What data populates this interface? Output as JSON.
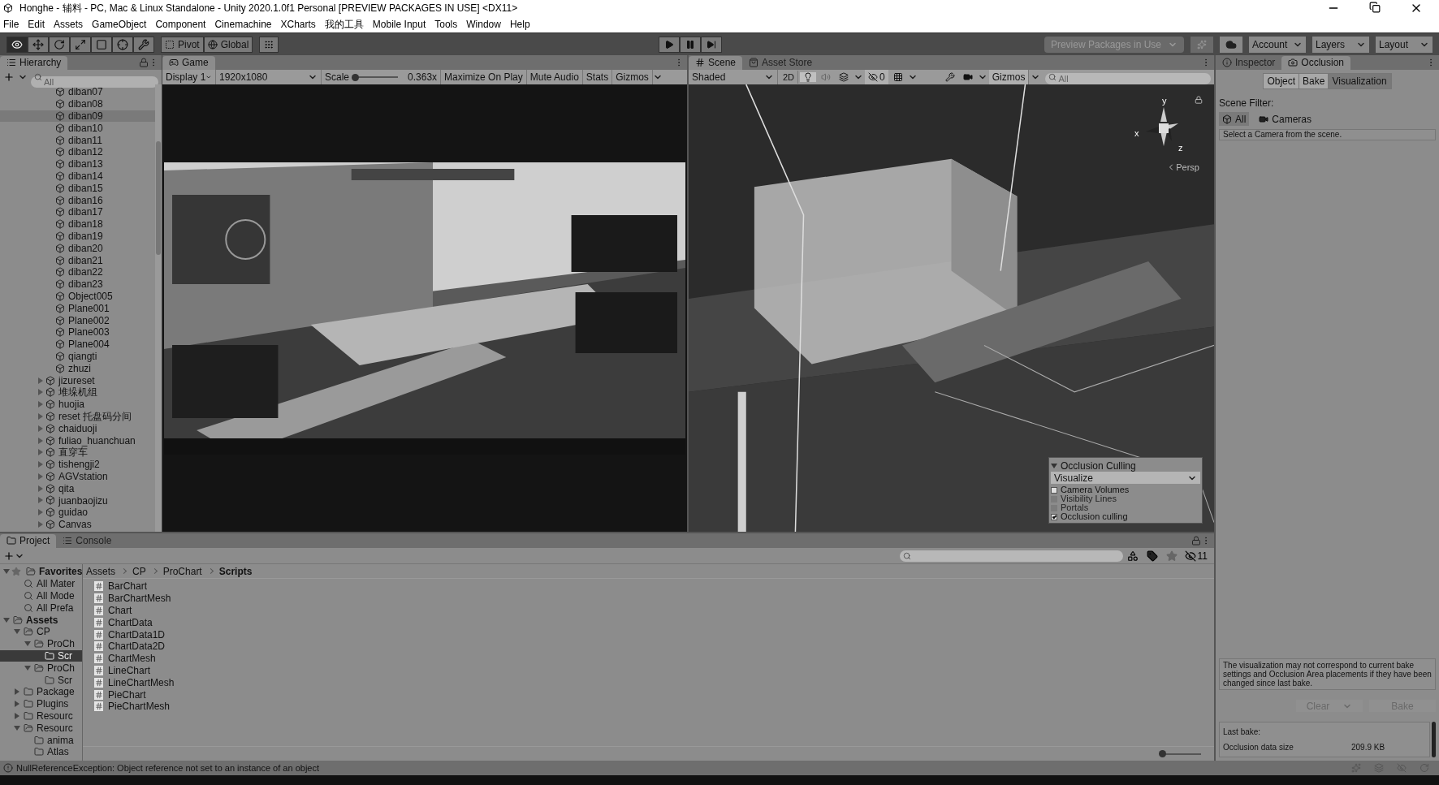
{
  "window": {
    "title": "Honghe - 辅料 - PC, Mac & Linux Standalone - Unity 2020.1.0f1 Personal [PREVIEW PACKAGES IN USE] <DX11>"
  },
  "menu": [
    "File",
    "Edit",
    "Assets",
    "GameObject",
    "Component",
    "Cinemachine",
    "XCharts",
    "我的工具",
    "Mobile Input",
    "Tools",
    "Window",
    "Help"
  ],
  "toolbar": {
    "tools": [
      {
        "kind": "view",
        "selected": true
      },
      {
        "kind": "move",
        "selected": false
      },
      {
        "kind": "rotate",
        "selected": false
      },
      {
        "kind": "scale",
        "selected": false
      },
      {
        "kind": "rect",
        "selected": false
      },
      {
        "kind": "transform",
        "selected": false
      },
      {
        "kind": "custom",
        "selected": false
      }
    ],
    "pivot": "Pivot",
    "space": "Global",
    "playback": [
      {
        "kind": "play",
        "on": false
      },
      {
        "kind": "pause",
        "on": false
      },
      {
        "kind": "step",
        "on": false
      }
    ],
    "preview_packages": {
      "label": "Preview Packages in Use",
      "disabled": true
    },
    "account": "Account",
    "layers": "Layers",
    "layout": "Layout"
  },
  "hierarchy": {
    "tab": "Hierarchy",
    "search_placeholder": "All",
    "items": [
      {
        "label": "diban07",
        "kind": "leaf",
        "selected": false
      },
      {
        "label": "diban08",
        "kind": "leaf",
        "selected": false
      },
      {
        "label": "diban09",
        "kind": "leaf",
        "selected": true
      },
      {
        "label": "diban10",
        "kind": "leaf",
        "selected": false
      },
      {
        "label": "diban11",
        "kind": "leaf",
        "selected": false
      },
      {
        "label": "diban12",
        "kind": "leaf",
        "selected": false
      },
      {
        "label": "diban13",
        "kind": "leaf",
        "selected": false
      },
      {
        "label": "diban14",
        "kind": "leaf",
        "selected": false
      },
      {
        "label": "diban15",
        "kind": "leaf",
        "selected": false
      },
      {
        "label": "diban16",
        "kind": "leaf",
        "selected": false
      },
      {
        "label": "diban17",
        "kind": "leaf",
        "selected": false
      },
      {
        "label": "diban18",
        "kind": "leaf",
        "selected": false
      },
      {
        "label": "diban19",
        "kind": "leaf",
        "selected": false
      },
      {
        "label": "diban20",
        "kind": "leaf",
        "selected": false
      },
      {
        "label": "diban21",
        "kind": "leaf",
        "selected": false
      },
      {
        "label": "diban22",
        "kind": "leaf",
        "selected": false
      },
      {
        "label": "diban23",
        "kind": "leaf",
        "selected": false
      },
      {
        "label": "Object005",
        "kind": "leaf",
        "selected": false
      },
      {
        "label": "Plane001",
        "kind": "leaf",
        "selected": false
      },
      {
        "label": "Plane002",
        "kind": "leaf",
        "selected": false
      },
      {
        "label": "Plane003",
        "kind": "leaf",
        "selected": false
      },
      {
        "label": "Plane004",
        "kind": "leaf",
        "selected": false
      },
      {
        "label": "qiangti",
        "kind": "leaf",
        "selected": false
      },
      {
        "label": "zhuzi",
        "kind": "leaf",
        "selected": false
      },
      {
        "label": "jizureset",
        "kind": "group",
        "expanded": false,
        "selected": false
      },
      {
        "label": "堆垛机组",
        "kind": "group",
        "expanded": false,
        "selected": false
      },
      {
        "label": "huojia",
        "kind": "group",
        "expanded": false,
        "selected": false
      },
      {
        "label": "reset 托盘码分间",
        "kind": "group",
        "expanded": false,
        "selected": false
      },
      {
        "label": "chaiduoji",
        "kind": "group",
        "expanded": false,
        "selected": false
      },
      {
        "label": "fuliao_huanchuan",
        "kind": "group",
        "expanded": false,
        "selected": false
      },
      {
        "label": "直穿车",
        "kind": "group",
        "expanded": false,
        "selected": false
      },
      {
        "label": "tishengji2",
        "kind": "group",
        "expanded": false,
        "selected": false
      },
      {
        "label": "AGVstation",
        "kind": "group",
        "expanded": false,
        "selected": false
      },
      {
        "label": "qita",
        "kind": "group",
        "expanded": false,
        "selected": false
      },
      {
        "label": "juanbaojizu",
        "kind": "group",
        "expanded": false,
        "selected": false
      },
      {
        "label": "guidao",
        "kind": "group",
        "expanded": false,
        "selected": false
      },
      {
        "label": "Canvas",
        "kind": "group",
        "expanded": false,
        "selected": false
      }
    ]
  },
  "game": {
    "tab": "Game",
    "display": "Display 1",
    "resolution": "1920x1080",
    "scale_label": "Scale",
    "scale": {
      "level": 0.05
    },
    "scale_value": "0.363x",
    "toggles": [
      {
        "label": "Maximize On Play",
        "on": false
      },
      {
        "label": "Mute Audio",
        "on": false
      },
      {
        "label": "Stats",
        "on": false
      }
    ],
    "gizmos": "Gizmos",
    "view": {
      "kind": "picture"
    }
  },
  "scene": {
    "tabs": [
      {
        "label": "Scene",
        "selected": true
      },
      {
        "label": "Asset Store",
        "selected": false
      }
    ],
    "shading": "Shaded",
    "mode_2d": {
      "label": "2D",
      "on": false
    },
    "lighting_on": true,
    "hidden_count": "0",
    "gizmos": "Gizmos",
    "search_placeholder": "All",
    "axes": [
      "y",
      "x",
      "z"
    ],
    "projection": "Persp",
    "view": {
      "kind": "picture"
    },
    "occlusion_overlay": {
      "title": "Occlusion Culling",
      "expanded": true,
      "mode": "Visualize",
      "options": [
        {
          "label": "Camera Volumes",
          "checked": false,
          "disabled": false
        },
        {
          "label": "Visibility Lines",
          "checked": false,
          "disabled": true
        },
        {
          "label": "Portals",
          "checked": false,
          "disabled": true
        },
        {
          "label": "Occlusion culling",
          "checked": true,
          "disabled": false
        }
      ]
    }
  },
  "project": {
    "tabs": [
      {
        "label": "Project",
        "selected": true
      },
      {
        "label": "Console",
        "selected": false
      }
    ],
    "hidden_count": "11",
    "tree": [
      {
        "label": "Favorites",
        "kind": "header",
        "expanded": true,
        "selected": false,
        "children": [
          {
            "label": "All Mater",
            "kind": "search",
            "selected": false
          },
          {
            "label": "All Mode",
            "kind": "search",
            "selected": false
          },
          {
            "label": "All Prefa",
            "kind": "search",
            "selected": false
          }
        ]
      },
      {
        "label": "Assets",
        "kind": "header",
        "expanded": true,
        "selected": false,
        "children": [
          {
            "label": "CP",
            "kind": "folder",
            "expanded": true,
            "selected": false,
            "children": [
              {
                "label": "ProCh",
                "kind": "folder",
                "expanded": true,
                "selected": false,
                "children": [
                  {
                    "label": "Scr",
                    "kind": "folder",
                    "selected": true
                  }
                ]
              },
              {
                "label": "ProCh",
                "kind": "folder",
                "expanded": true,
                "selected": false,
                "children": [
                  {
                    "label": "Scr",
                    "kind": "folder",
                    "selected": false
                  }
                ]
              }
            ]
          },
          {
            "label": "Package",
            "kind": "folder",
            "expanded": false,
            "selected": false
          },
          {
            "label": "Plugins",
            "kind": "folder",
            "expanded": false,
            "selected": false
          },
          {
            "label": "Resourc",
            "kind": "folder",
            "expanded": false,
            "selected": false
          },
          {
            "label": "Resourc",
            "kind": "folder",
            "expanded": true,
            "selected": false,
            "children": [
              {
                "label": "anima",
                "kind": "folder",
                "selected": false
              },
              {
                "label": "Atlas",
                "kind": "folder",
                "selected": false
              }
            ]
          }
        ]
      }
    ],
    "breadcrumb": [
      "Assets",
      "CP",
      "ProChart",
      "Scripts"
    ],
    "files": [
      "BarChart",
      "BarChartMesh",
      "Chart",
      "ChartData",
      "ChartData1D",
      "ChartData2D",
      "ChartMesh",
      "LineChart",
      "LineChartMesh",
      "PieChart",
      "PieChartMesh"
    ],
    "zoom": {
      "level": 0.0
    }
  },
  "inspector": {
    "tabs": [
      {
        "label": "Inspector",
        "selected": false
      },
      {
        "label": "Occlusion",
        "selected": true
      }
    ],
    "modes": [
      {
        "label": "Object",
        "selected": false
      },
      {
        "label": "Bake",
        "selected": false
      },
      {
        "label": "Visualization",
        "selected": true
      }
    ],
    "scene_filter_label": "Scene Filter:",
    "filters": [
      {
        "label": "All",
        "selected": true
      },
      {
        "label": "Cameras",
        "selected": false
      }
    ],
    "camera_field": "Select a Camera from the scene.",
    "help": "The visualization may not correspond to current bake settings and Occlusion Area placements if they have been changed since last bake.",
    "buttons": [
      {
        "label": "Clear",
        "kind": "dropdown",
        "disabled": true
      },
      {
        "label": "Bake",
        "kind": "plain",
        "disabled": true
      }
    ],
    "last_bake_label": "Last bake:",
    "data_size_label": "Occlusion data size",
    "data_size": "209.9 KB"
  },
  "status_bar": {
    "message": "NullReferenceException: Object reference not set to an instance of an object"
  }
}
